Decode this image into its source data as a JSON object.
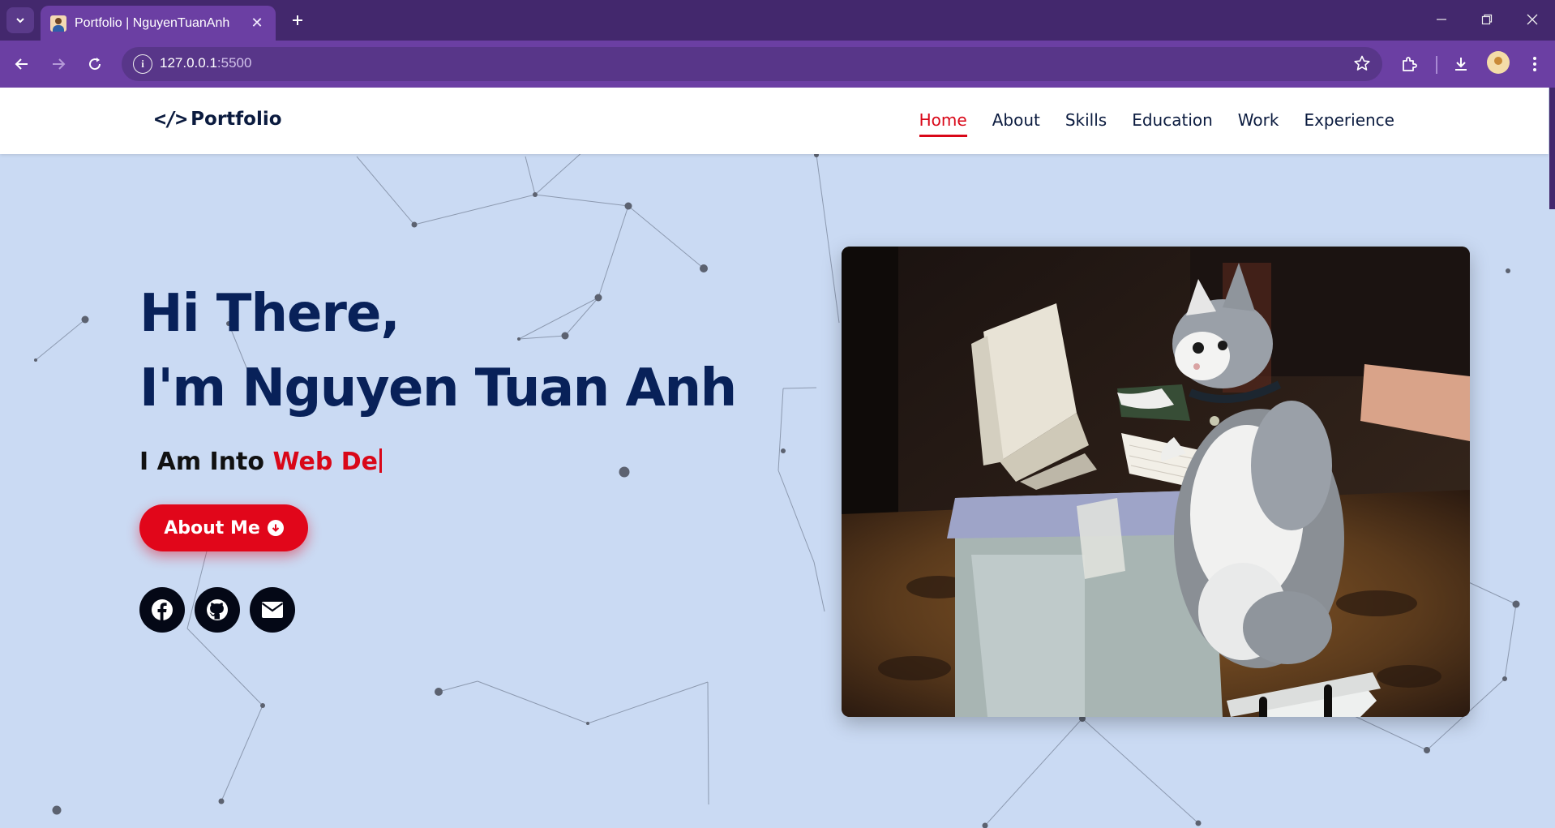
{
  "browser": {
    "tab_title": "Portfolio | NguyenTuanAnh",
    "url_host": "127.0.0.1",
    "url_port": ":5500",
    "icons": [
      "tab-search-icon",
      "close-icon",
      "plus-icon",
      "minimize-icon",
      "restore-icon",
      "back-icon",
      "forward-icon",
      "reload-icon",
      "info-icon",
      "star-icon",
      "extensions-icon",
      "download-icon",
      "menu-icon"
    ]
  },
  "header": {
    "brand_icon": "</>",
    "brand": "Portfolio",
    "nav": [
      {
        "label": "Home",
        "active": true
      },
      {
        "label": "About",
        "active": false
      },
      {
        "label": "Skills",
        "active": false
      },
      {
        "label": "Education",
        "active": false
      },
      {
        "label": "Work",
        "active": false
      },
      {
        "label": "Experience",
        "active": false
      }
    ]
  },
  "hero": {
    "greeting": "Hi There,",
    "name": "I'm Nguyen Tuan Anh",
    "typed_prefix": "I Am Into ",
    "typed_text": "Web De",
    "cta_label": "About Me",
    "socials": [
      {
        "name": "facebook",
        "icon": "facebook-icon"
      },
      {
        "name": "github",
        "icon": "github-icon"
      },
      {
        "name": "email",
        "icon": "envelope-icon"
      }
    ],
    "image_subject": "kitten typing on a retro computer"
  },
  "colors": {
    "accent": "#d90718",
    "heading": "#082159",
    "background": "#cadaf3",
    "chrome_dark": "#43286d",
    "chrome": "#6b3fa3"
  }
}
